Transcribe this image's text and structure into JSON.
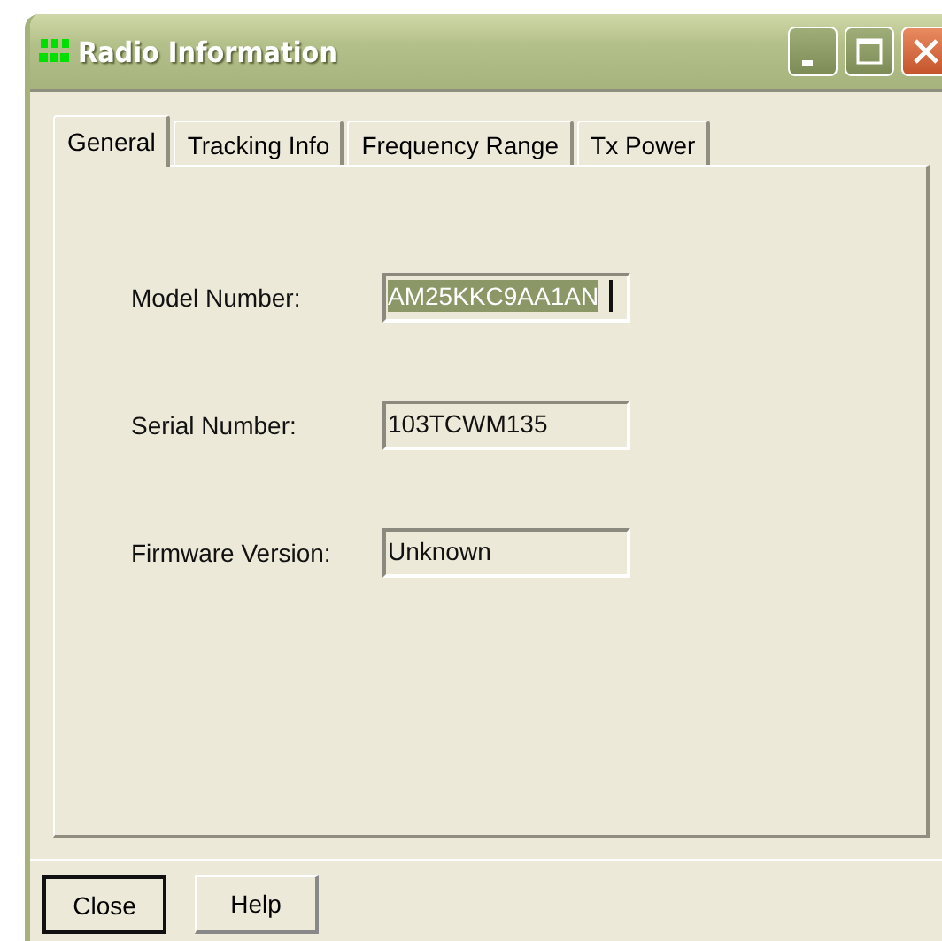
{
  "window": {
    "title": "Radio Information"
  },
  "tabs": [
    {
      "label": "General",
      "selected": true
    },
    {
      "label": "Tracking Info",
      "selected": false
    },
    {
      "label": "Frequency Range",
      "selected": false
    },
    {
      "label": "Tx Power",
      "selected": false
    }
  ],
  "fields": [
    {
      "label": "Model Number:",
      "value": "AM25KKC9AA1AN",
      "text_selected": true
    },
    {
      "label": "Serial Number:",
      "value": "103TCWM135",
      "text_selected": false
    },
    {
      "label": "Firmware Version:",
      "value": "Unknown",
      "text_selected": false
    }
  ],
  "buttons": [
    {
      "label": "Close",
      "default": true
    },
    {
      "label": "Help",
      "default": false
    }
  ]
}
